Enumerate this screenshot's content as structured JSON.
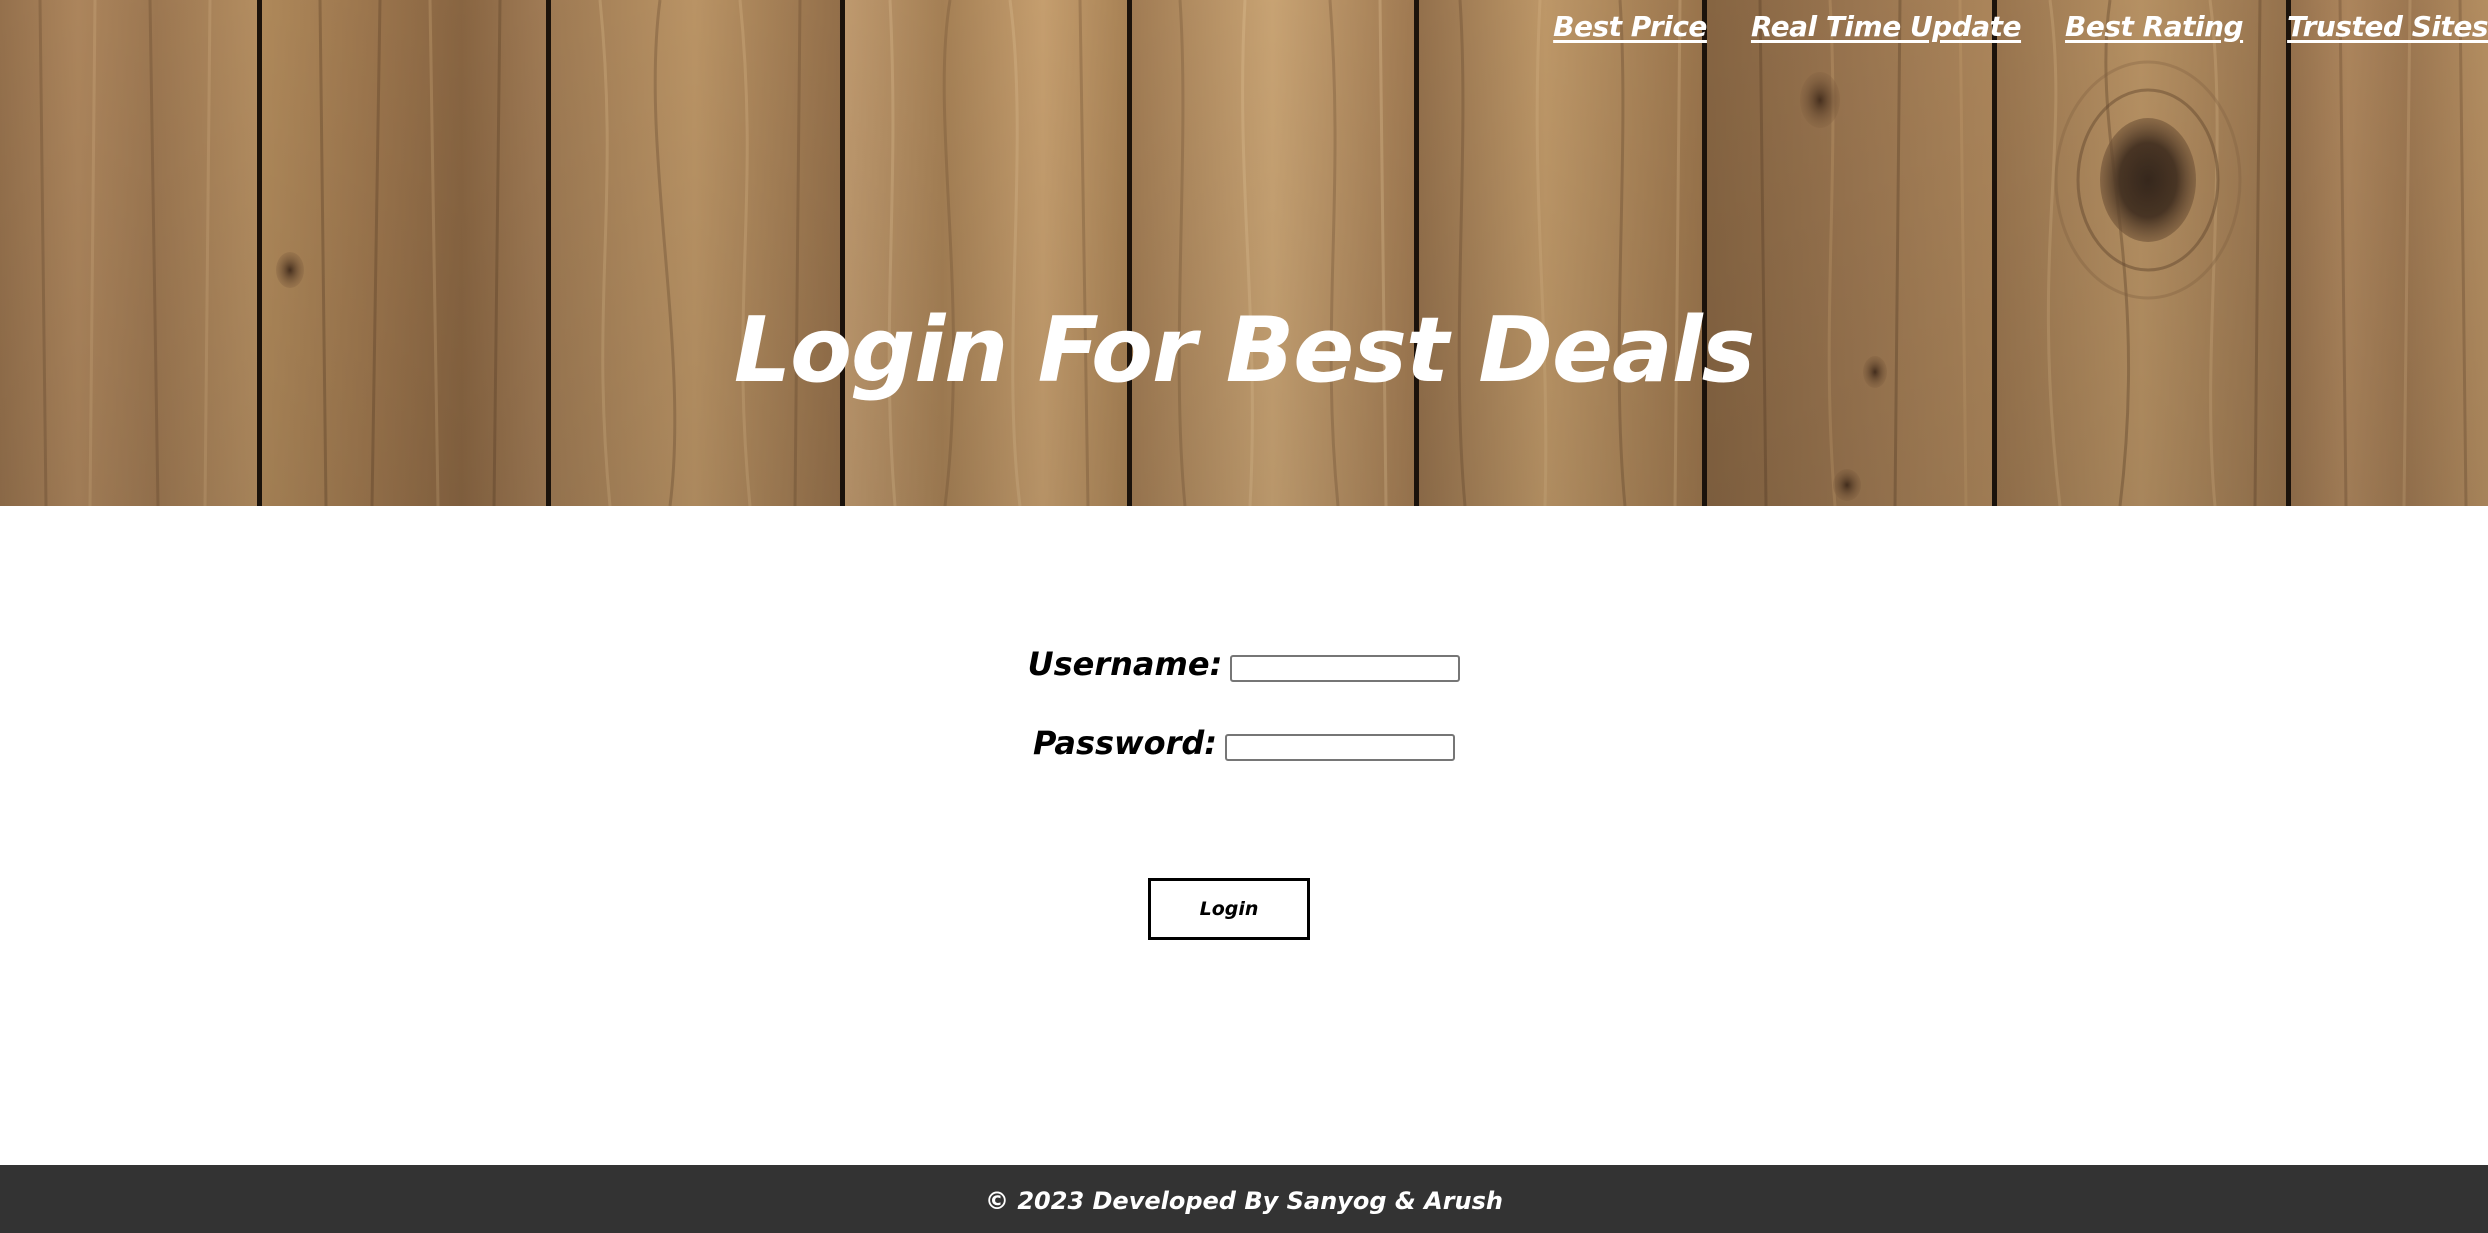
{
  "nav": {
    "items": [
      {
        "label": "Best Price"
      },
      {
        "label": "Real Time Update"
      },
      {
        "label": "Best Rating"
      },
      {
        "label": "Trusted Sites"
      }
    ]
  },
  "hero": {
    "title": "Login For Best Deals",
    "background": "wooden-planks-texture"
  },
  "form": {
    "username_label": "Username:",
    "username_value": "",
    "password_label": "Password:",
    "password_value": "",
    "login_label": "Login"
  },
  "footer": {
    "text": "© 2023 Developed By Sanyog & Arush"
  },
  "colors": {
    "wood_base": "#a98258",
    "wood_light": "#c9a06c",
    "wood_dark": "#6e4f33",
    "plank_gap": "#1e140c",
    "footer_bg": "#333333",
    "text_dark": "#000000",
    "text_light": "#ffffff"
  }
}
